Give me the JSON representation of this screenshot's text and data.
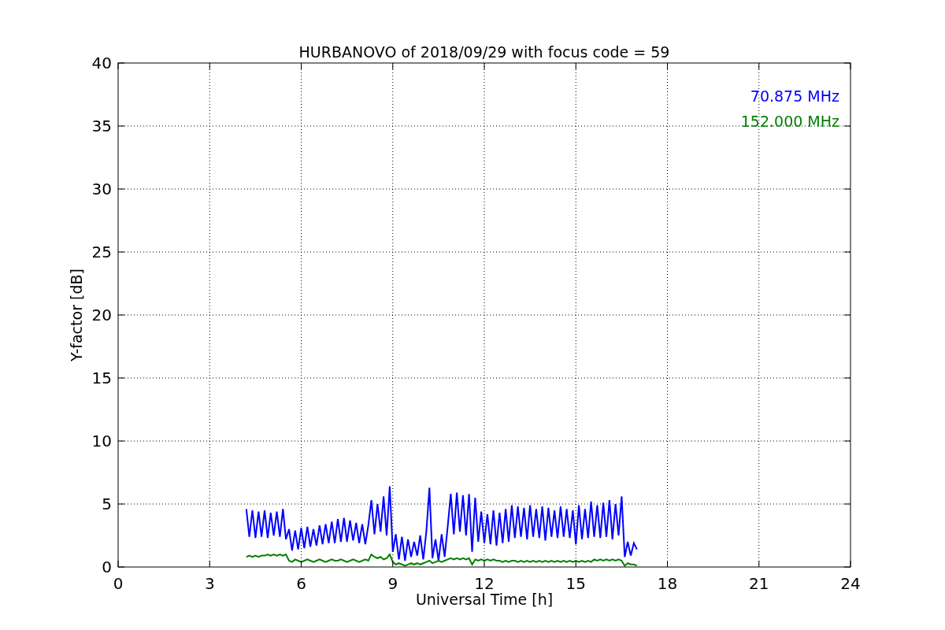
{
  "chart_data": {
    "type": "line",
    "title": "HURBANOVO of 2018/09/29 with focus code = 59",
    "xlabel": "Universal Time [h]",
    "ylabel": "Y-factor [dB]",
    "grid": true,
    "xlim": [
      0,
      24
    ],
    "ylim": [
      0,
      40
    ],
    "xticks": [
      0,
      3,
      6,
      9,
      12,
      15,
      18,
      21,
      24
    ],
    "yticks": [
      0,
      5,
      10,
      15,
      20,
      25,
      30,
      35,
      40
    ],
    "x": [
      4.2,
      4.3,
      4.4,
      4.5,
      4.6,
      4.7,
      4.8,
      4.9,
      5.0,
      5.1,
      5.2,
      5.3,
      5.4,
      5.5,
      5.6,
      5.7,
      5.8,
      5.9,
      6.0,
      6.1,
      6.2,
      6.3,
      6.4,
      6.5,
      6.6,
      6.7,
      6.8,
      6.9,
      7.0,
      7.1,
      7.2,
      7.3,
      7.4,
      7.5,
      7.6,
      7.7,
      7.8,
      7.9,
      8.0,
      8.1,
      8.2,
      8.3,
      8.4,
      8.5,
      8.6,
      8.7,
      8.8,
      8.9,
      9.0,
      9.1,
      9.2,
      9.3,
      9.4,
      9.5,
      9.6,
      9.7,
      9.8,
      9.9,
      10.0,
      10.1,
      10.2,
      10.3,
      10.4,
      10.5,
      10.6,
      10.7,
      10.8,
      10.9,
      11.0,
      11.1,
      11.2,
      11.3,
      11.4,
      11.5,
      11.6,
      11.7,
      11.8,
      11.9,
      12.0,
      12.1,
      12.2,
      12.3,
      12.4,
      12.5,
      12.6,
      12.7,
      12.8,
      12.9,
      13.0,
      13.1,
      13.2,
      13.3,
      13.4,
      13.5,
      13.6,
      13.7,
      13.8,
      13.9,
      14.0,
      14.1,
      14.2,
      14.3,
      14.4,
      14.5,
      14.6,
      14.7,
      14.8,
      14.9,
      15.0,
      15.1,
      15.2,
      15.3,
      15.4,
      15.5,
      15.6,
      15.7,
      15.8,
      15.9,
      16.0,
      16.1,
      16.2,
      16.3,
      16.4,
      16.5,
      16.6,
      16.7,
      16.8,
      16.9,
      17.0
    ],
    "series": [
      {
        "name": "70.875 MHz",
        "color": "#0000ff",
        "values": [
          4.6,
          2.4,
          4.5,
          2.3,
          4.4,
          2.4,
          4.5,
          2.3,
          4.3,
          2.5,
          4.4,
          2.4,
          4.6,
          2.2,
          3.0,
          1.3,
          2.9,
          1.4,
          3.1,
          1.5,
          3.2,
          1.6,
          3.0,
          1.7,
          3.3,
          1.8,
          3.4,
          1.9,
          3.6,
          1.9,
          3.8,
          2.0,
          3.9,
          2.0,
          3.7,
          2.1,
          3.5,
          1.9,
          3.4,
          1.8,
          3.3,
          5.3,
          2.6,
          5.0,
          2.8,
          5.6,
          2.5,
          6.4,
          1.2,
          2.6,
          0.6,
          2.4,
          0.5,
          2.2,
          0.8,
          2.0,
          0.9,
          2.5,
          0.6,
          2.8,
          6.3,
          0.7,
          2.2,
          0.5,
          2.6,
          0.8,
          3.2,
          5.8,
          2.6,
          5.9,
          2.8,
          5.7,
          2.5,
          5.8,
          1.2,
          5.5,
          2.0,
          4.4,
          1.9,
          4.2,
          1.8,
          4.5,
          1.7,
          4.3,
          1.9,
          4.6,
          2.0,
          4.9,
          2.3,
          4.8,
          2.4,
          4.7,
          2.2,
          4.9,
          2.4,
          4.6,
          2.3,
          4.8,
          2.1,
          4.7,
          2.4,
          4.5,
          2.3,
          4.8,
          2.4,
          4.6,
          2.3,
          4.5,
          1.8,
          4.9,
          2.2,
          4.6,
          2.3,
          5.2,
          2.4,
          4.9,
          2.3,
          5.1,
          2.4,
          5.3,
          2.2,
          5.0,
          2.5,
          5.6,
          0.8,
          2.0,
          0.9,
          1.9,
          1.4
        ]
      },
      {
        "name": "152.000 MHz",
        "color": "#008000",
        "values": [
          0.8,
          0.9,
          0.8,
          0.9,
          0.8,
          0.9,
          0.9,
          1.0,
          0.9,
          1.0,
          0.9,
          1.0,
          0.9,
          1.0,
          0.5,
          0.4,
          0.6,
          0.5,
          0.4,
          0.5,
          0.6,
          0.5,
          0.4,
          0.5,
          0.6,
          0.5,
          0.4,
          0.5,
          0.6,
          0.5,
          0.5,
          0.6,
          0.5,
          0.4,
          0.5,
          0.6,
          0.5,
          0.4,
          0.5,
          0.6,
          0.5,
          1.0,
          0.8,
          0.7,
          0.8,
          0.6,
          0.7,
          1.0,
          0.4,
          0.2,
          0.3,
          0.2,
          0.1,
          0.2,
          0.3,
          0.2,
          0.3,
          0.2,
          0.3,
          0.4,
          0.5,
          0.3,
          0.4,
          0.5,
          0.4,
          0.5,
          0.6,
          0.7,
          0.6,
          0.7,
          0.6,
          0.7,
          0.6,
          0.7,
          0.2,
          0.6,
          0.5,
          0.6,
          0.5,
          0.6,
          0.5,
          0.6,
          0.5,
          0.5,
          0.4,
          0.5,
          0.4,
          0.5,
          0.5,
          0.4,
          0.5,
          0.4,
          0.5,
          0.4,
          0.5,
          0.4,
          0.5,
          0.4,
          0.5,
          0.4,
          0.5,
          0.4,
          0.5,
          0.4,
          0.5,
          0.4,
          0.5,
          0.4,
          0.5,
          0.4,
          0.5,
          0.4,
          0.5,
          0.4,
          0.6,
          0.5,
          0.6,
          0.5,
          0.6,
          0.5,
          0.6,
          0.5,
          0.6,
          0.5,
          0.1,
          0.3,
          0.2,
          0.2,
          0.1
        ]
      }
    ]
  }
}
